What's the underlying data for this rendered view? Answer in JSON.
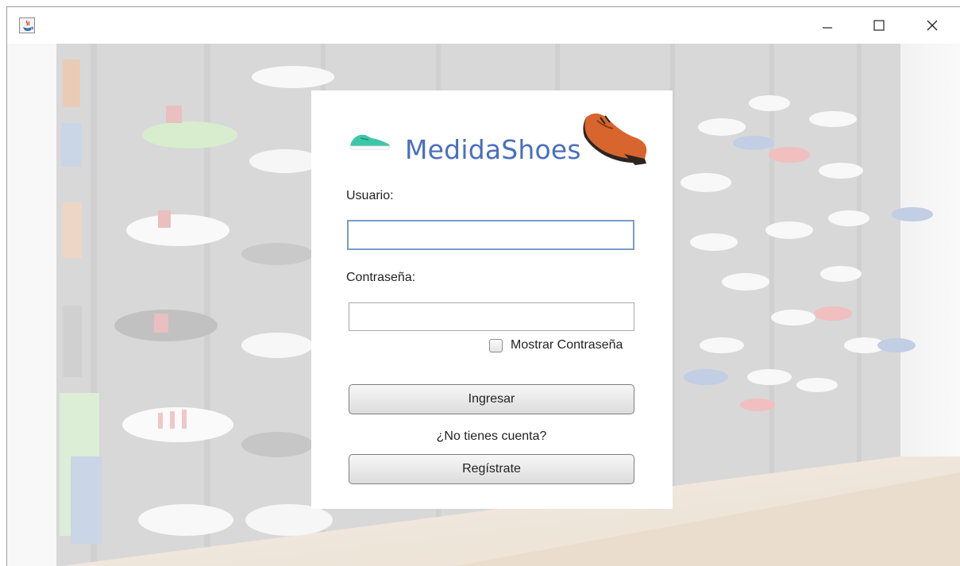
{
  "window": {
    "controls": {
      "minimize": "minimize-icon",
      "maximize": "maximize-icon",
      "close": "close-icon"
    }
  },
  "login": {
    "brand": "MedidaShoes",
    "user_label": "Usuario:",
    "user_value": "",
    "pass_label": "Contraseña:",
    "pass_value": "",
    "show_password_label": "Mostrar Contraseña",
    "show_password_checked": false,
    "login_button": "Ingresar",
    "no_account_text": "¿No tienes cuenta?",
    "register_button": "Regístrate"
  },
  "colors": {
    "brand_text": "#4a6fbe",
    "focused_border": "#7a9cc6"
  }
}
